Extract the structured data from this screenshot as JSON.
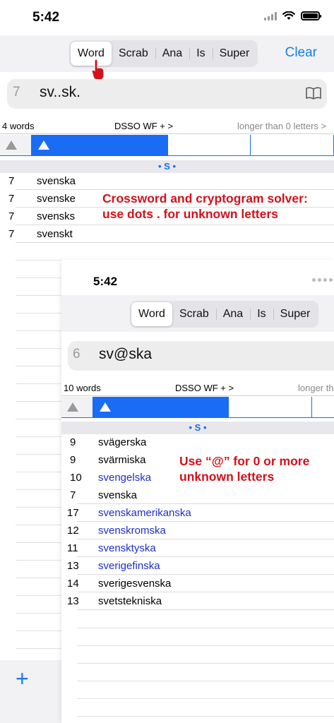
{
  "status": {
    "time": "5:42"
  },
  "toolbar": {
    "segments": [
      "Word",
      "Scrab",
      "Ana",
      "Is",
      "Super"
    ],
    "active": "Word",
    "clear": "Clear"
  },
  "search": {
    "length": "7",
    "query": "sv..sk.",
    "icon": "book-icon"
  },
  "info": {
    "count": "4 words",
    "dsso": "DSSO  WF  + >",
    "longer": "longer than 0 letters >"
  },
  "section": "• S •",
  "results": [
    {
      "len": "7",
      "word": "svenska"
    },
    {
      "len": "7",
      "word": "svenske"
    },
    {
      "len": "7",
      "word": "svensks"
    },
    {
      "len": "7",
      "word": "svenskt"
    }
  ],
  "annotation1": {
    "line1": "Crossword and cryptogram solver:",
    "line2": "use dots . for unknown letters"
  },
  "panel2": {
    "time": "5:42",
    "segments": [
      "Word",
      "Scrab",
      "Ana",
      "Is",
      "Super"
    ],
    "search": {
      "length": "6",
      "query": "sv@ska"
    },
    "info": {
      "count": "10 words",
      "dsso": "DSSO  WF  + >",
      "longer": "longer th"
    },
    "section": "• S •",
    "results": [
      {
        "len": "9",
        "word": "svägerska",
        "color": "black"
      },
      {
        "len": "9",
        "word": "svärmiska",
        "color": "black"
      },
      {
        "len": "10",
        "word": "svengelska",
        "color": "blue"
      },
      {
        "len": "7",
        "word": "svenska",
        "color": "black"
      },
      {
        "len": "17",
        "word": "svenskamerikanska",
        "color": "blue"
      },
      {
        "len": "12",
        "word": "svenskromska",
        "color": "blue"
      },
      {
        "len": "11",
        "word": "svensktyska",
        "color": "blue"
      },
      {
        "len": "13",
        "word": "sverigefinska",
        "color": "blue"
      },
      {
        "len": "14",
        "word": "sverigesvenska",
        "color": "black"
      },
      {
        "len": "13",
        "word": "svetstekniska",
        "color": "black"
      }
    ],
    "annotation": {
      "line1": "Use “@” for 0 or more",
      "line2": "unknown letters"
    }
  },
  "add_button": "+",
  "colors": {
    "accent": "#1a7cf0",
    "sortBlue": "#1a6cf5",
    "annotation": "#d4111b",
    "linkWord": "#1d2fc7"
  }
}
